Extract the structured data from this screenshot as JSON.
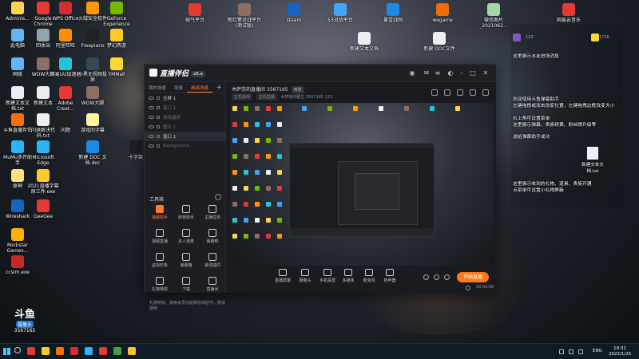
{
  "desktop": {
    "left_icons": [
      {
        "label": "Adminis...",
        "color": "#ffd54f"
      },
      {
        "label": "Google Chrome",
        "color": "#e53935"
      },
      {
        "label": "WPS Office",
        "color": "#d32f2f"
      },
      {
        "label": "火绒安全软件",
        "color": "#ff9800"
      },
      {
        "label": "GeForce Experience",
        "color": "#76b900"
      },
      {
        "label": "云电脑",
        "color": "#42a5f5"
      },
      {
        "label": "此电脑",
        "color": "#64b5f6"
      },
      {
        "label": "回收站",
        "color": "#90a4ae"
      },
      {
        "label": "阿里旺旺",
        "color": "#ff8f00"
      },
      {
        "label": "Freepiano",
        "color": "#212121"
      },
      {
        "label": "梦幻西游",
        "color": "#ffca28"
      },
      {
        "label": "网络",
        "color": "#64b5f6"
      },
      {
        "label": "WOW大脚",
        "color": "#8d6e63"
      },
      {
        "label": "网易UU加速器",
        "color": "#26c6da"
      },
      {
        "label": "小黑无视频投屏",
        "color": "#37474f"
      },
      {
        "label": "YMMall",
        "color": "#fdd835"
      },
      {
        "label": "新建文本文档.txt",
        "color": "#eceff1"
      },
      {
        "label": "新建文本",
        "color": "#eceff1"
      },
      {
        "label": "Adobe Creat...",
        "color": "#e53935"
      },
      {
        "label": "WOW大脚",
        "color": "#8d6e63"
      },
      {
        "label": "斗鱼直播伴侣",
        "color": "#ff6f00"
      },
      {
        "label": "闪退解决代码.txt",
        "color": "#eceff1"
      },
      {
        "label": "游戏的字幕",
        "color": "#fff59d"
      },
      {
        "label": "MuMu多开助手",
        "color": "#29b6f6"
      },
      {
        "label": "Microsoft Edge",
        "color": "#29b6f6"
      },
      {
        "label": "原神",
        "color": "#ffe082"
      },
      {
        "label": "2021直播字幕原三件.exe",
        "color": "#ffca28"
      },
      {
        "label": "问题",
        "color": "#212121"
      },
      {
        "label": "新建 DOC 文档.doc",
        "color": "#1e88e5"
      },
      {
        "label": "Wireshark",
        "color": "#1565c0"
      },
      {
        "label": "GeeGee",
        "color": "#e53935"
      },
      {
        "label": "EV录屏",
        "color": "#212121"
      },
      {
        "label": "Rockstar Games...",
        "color": "#ffb300"
      },
      {
        "label": "ccsim.exe",
        "color": "#c62828"
      }
    ],
    "top_icons": [
      {
        "label": "帧气平台",
        "color": "#e53935"
      },
      {
        "label": "新红警对战平台(测试版)",
        "color": "#8d6e63"
      },
      {
        "label": "steam",
        "color": "#1565c0"
      },
      {
        "label": "53对战平台",
        "color": "#42a5f5"
      },
      {
        "label": "暴雪战网",
        "color": "#1e88e5"
      },
      {
        "label": "wegame",
        "color": "#ef6c00"
      },
      {
        "label": "微信图片_2021062...",
        "color": "#a5d6a7"
      },
      {
        "label": "网易云音乐",
        "color": "#e53935"
      }
    ],
    "middle_icons": [
      {
        "label": "新建文本文档",
        "color": "#eceff1"
      },
      {
        "label": "新建 DOC文件",
        "color": "#eceff1"
      },
      {
        "label": "十字架",
        "color": "#212121"
      }
    ],
    "right_lower_icons": [
      {
        "label": "新建文本文档.txt",
        "color": "#eceff1"
      }
    ]
  },
  "studio": {
    "logo_text": "直播伴侣",
    "logo_badge": "v5.x",
    "scene_tabs": [
      "我的场景",
      "场景",
      "画面场景"
    ],
    "sources": [
      {
        "label": "全屏 1",
        "state": "normal"
      },
      {
        "label": "窗口 1",
        "state": "dim"
      },
      {
        "label": "游戏捕获",
        "state": "dim"
      },
      {
        "label": "图片 1",
        "state": "dim"
      },
      {
        "label": "窗口 1",
        "state": "sel"
      },
      {
        "label": "Background",
        "state": "dim"
      }
    ],
    "tools_title": "工具箱",
    "tools": [
      "弹幕助手",
      "房管助手",
      "主播任务",
      "视频直播",
      "多人连麦",
      "弹幕鸭",
      "虚拟形象",
      "弹幕箱",
      "歌词插件",
      "礼物特效",
      "下载",
      "直播间"
    ],
    "left_status": "礼物特效、高级会员功能等您体验中，敬请期待",
    "room_title": "木萨劳的直播间 3567165",
    "room_edit": "修改",
    "room_tags": [
      "主机游戏",
      "主机直播",
      "木萨劳的腰王",
      "3567165"
    ],
    "viewer_count": "123",
    "bottom_actions": [
      "直播屏幕",
      "摄像头",
      "手机投屏",
      "多媒体",
      "麦克风",
      "扬声器"
    ],
    "stream_button": "开始直播",
    "timer": "00:00:00"
  },
  "chat": {
    "count_left": "123",
    "count_right": "1726",
    "lines": [
      "这里展示水友进场消息",
      "欢迎使用斗鱼弹幕助手",
      "左键拖拽或双击改变位置，左键拖拽边框改变大小",
      "右上角可设置菜单",
      "这里展示弹幕、贵族续费、粉丝牌升级等",
      "送给弹幕助手成功",
      "这里展示收到的礼物、道具、贵族开通",
      "点菜单可设置小礼物屏蔽"
    ]
  },
  "douyu": {
    "brand": "斗鱼",
    "name": "摄像头",
    "room_id": "3567165"
  },
  "taskbar": {
    "apps": [
      {
        "name": "chrome",
        "color": "#e53935"
      },
      {
        "name": "folder",
        "color": "#ffca28"
      },
      {
        "name": "douyu",
        "color": "#ff6f00"
      },
      {
        "name": "wps",
        "color": "#d32f2f"
      },
      {
        "name": "edge",
        "color": "#29b6f6"
      },
      {
        "name": "app",
        "color": "#e53935"
      },
      {
        "name": "wechat",
        "color": "#43a047"
      },
      {
        "name": "studio",
        "color": "#fbc02d"
      }
    ],
    "lang": "ENG",
    "time": "19:31",
    "date": "2022/1/25"
  },
  "colors": {
    "accent": "#ff7a1a",
    "window_bg": "#1b1c21",
    "taskbar_bg": "#0e1a24"
  }
}
